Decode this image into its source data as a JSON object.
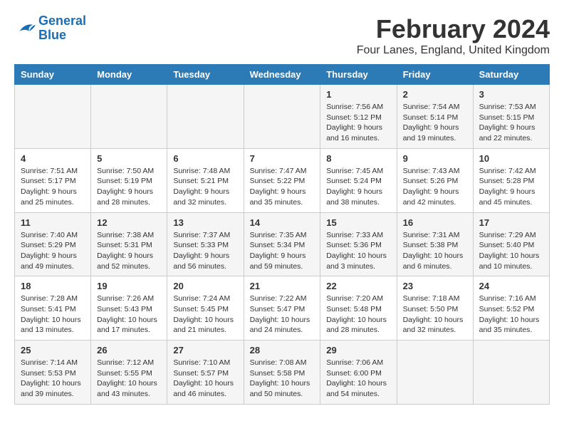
{
  "logo": {
    "line1": "General",
    "line2": "Blue"
  },
  "title": "February 2024",
  "subtitle": "Four Lanes, England, United Kingdom",
  "headers": [
    "Sunday",
    "Monday",
    "Tuesday",
    "Wednesday",
    "Thursday",
    "Friday",
    "Saturday"
  ],
  "weeks": [
    [
      {
        "day": "",
        "info": ""
      },
      {
        "day": "",
        "info": ""
      },
      {
        "day": "",
        "info": ""
      },
      {
        "day": "",
        "info": ""
      },
      {
        "day": "1",
        "info": "Sunrise: 7:56 AM\nSunset: 5:12 PM\nDaylight: 9 hours and 16 minutes."
      },
      {
        "day": "2",
        "info": "Sunrise: 7:54 AM\nSunset: 5:14 PM\nDaylight: 9 hours and 19 minutes."
      },
      {
        "day": "3",
        "info": "Sunrise: 7:53 AM\nSunset: 5:15 PM\nDaylight: 9 hours and 22 minutes."
      }
    ],
    [
      {
        "day": "4",
        "info": "Sunrise: 7:51 AM\nSunset: 5:17 PM\nDaylight: 9 hours and 25 minutes."
      },
      {
        "day": "5",
        "info": "Sunrise: 7:50 AM\nSunset: 5:19 PM\nDaylight: 9 hours and 28 minutes."
      },
      {
        "day": "6",
        "info": "Sunrise: 7:48 AM\nSunset: 5:21 PM\nDaylight: 9 hours and 32 minutes."
      },
      {
        "day": "7",
        "info": "Sunrise: 7:47 AM\nSunset: 5:22 PM\nDaylight: 9 hours and 35 minutes."
      },
      {
        "day": "8",
        "info": "Sunrise: 7:45 AM\nSunset: 5:24 PM\nDaylight: 9 hours and 38 minutes."
      },
      {
        "day": "9",
        "info": "Sunrise: 7:43 AM\nSunset: 5:26 PM\nDaylight: 9 hours and 42 minutes."
      },
      {
        "day": "10",
        "info": "Sunrise: 7:42 AM\nSunset: 5:28 PM\nDaylight: 9 hours and 45 minutes."
      }
    ],
    [
      {
        "day": "11",
        "info": "Sunrise: 7:40 AM\nSunset: 5:29 PM\nDaylight: 9 hours and 49 minutes."
      },
      {
        "day": "12",
        "info": "Sunrise: 7:38 AM\nSunset: 5:31 PM\nDaylight: 9 hours and 52 minutes."
      },
      {
        "day": "13",
        "info": "Sunrise: 7:37 AM\nSunset: 5:33 PM\nDaylight: 9 hours and 56 minutes."
      },
      {
        "day": "14",
        "info": "Sunrise: 7:35 AM\nSunset: 5:34 PM\nDaylight: 9 hours and 59 minutes."
      },
      {
        "day": "15",
        "info": "Sunrise: 7:33 AM\nSunset: 5:36 PM\nDaylight: 10 hours and 3 minutes."
      },
      {
        "day": "16",
        "info": "Sunrise: 7:31 AM\nSunset: 5:38 PM\nDaylight: 10 hours and 6 minutes."
      },
      {
        "day": "17",
        "info": "Sunrise: 7:29 AM\nSunset: 5:40 PM\nDaylight: 10 hours and 10 minutes."
      }
    ],
    [
      {
        "day": "18",
        "info": "Sunrise: 7:28 AM\nSunset: 5:41 PM\nDaylight: 10 hours and 13 minutes."
      },
      {
        "day": "19",
        "info": "Sunrise: 7:26 AM\nSunset: 5:43 PM\nDaylight: 10 hours and 17 minutes."
      },
      {
        "day": "20",
        "info": "Sunrise: 7:24 AM\nSunset: 5:45 PM\nDaylight: 10 hours and 21 minutes."
      },
      {
        "day": "21",
        "info": "Sunrise: 7:22 AM\nSunset: 5:47 PM\nDaylight: 10 hours and 24 minutes."
      },
      {
        "day": "22",
        "info": "Sunrise: 7:20 AM\nSunset: 5:48 PM\nDaylight: 10 hours and 28 minutes."
      },
      {
        "day": "23",
        "info": "Sunrise: 7:18 AM\nSunset: 5:50 PM\nDaylight: 10 hours and 32 minutes."
      },
      {
        "day": "24",
        "info": "Sunrise: 7:16 AM\nSunset: 5:52 PM\nDaylight: 10 hours and 35 minutes."
      }
    ],
    [
      {
        "day": "25",
        "info": "Sunrise: 7:14 AM\nSunset: 5:53 PM\nDaylight: 10 hours and 39 minutes."
      },
      {
        "day": "26",
        "info": "Sunrise: 7:12 AM\nSunset: 5:55 PM\nDaylight: 10 hours and 43 minutes."
      },
      {
        "day": "27",
        "info": "Sunrise: 7:10 AM\nSunset: 5:57 PM\nDaylight: 10 hours and 46 minutes."
      },
      {
        "day": "28",
        "info": "Sunrise: 7:08 AM\nSunset: 5:58 PM\nDaylight: 10 hours and 50 minutes."
      },
      {
        "day": "29",
        "info": "Sunrise: 7:06 AM\nSunset: 6:00 PM\nDaylight: 10 hours and 54 minutes."
      },
      {
        "day": "",
        "info": ""
      },
      {
        "day": "",
        "info": ""
      }
    ]
  ]
}
